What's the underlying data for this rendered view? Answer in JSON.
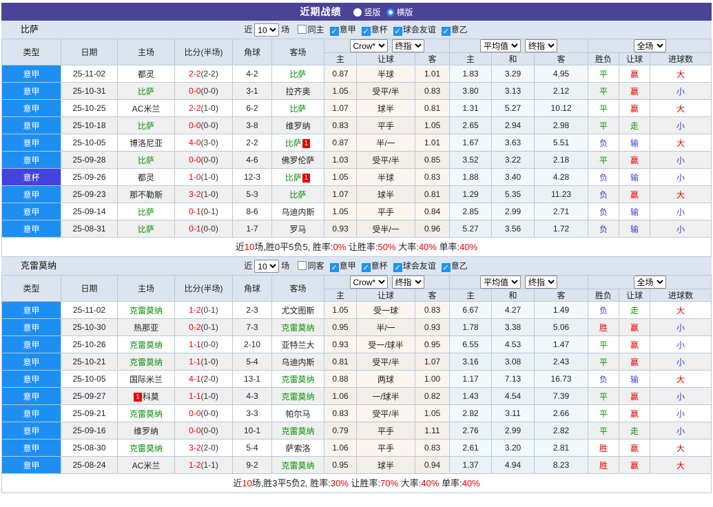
{
  "title_bar": {
    "title": "近期战绩",
    "radios": [
      {
        "label": "竖版",
        "selected": false
      },
      {
        "label": "横版",
        "selected": true
      }
    ]
  },
  "table_header": {
    "left_cols": [
      "类型",
      "日期",
      "主场",
      "比分(半场)",
      "角球",
      "客场"
    ],
    "groups": [
      {
        "selects": [
          {
            "label": "Crow*",
            "name": "bookmaker-select"
          },
          {
            "label": "终指",
            "name": "final-handicap-select"
          }
        ],
        "cols": [
          "主",
          "让球",
          "客"
        ]
      },
      {
        "selects": [
          {
            "label": "平均值",
            "name": "average-select"
          },
          {
            "label": "终指",
            "name": "final-average-select"
          }
        ],
        "cols": [
          "主",
          "和",
          "客"
        ]
      },
      {
        "selects": [
          {
            "label": "全场",
            "name": "scope-select"
          }
        ],
        "cols": [
          "胜负",
          "让球",
          "进球数"
        ]
      }
    ]
  },
  "sections": [
    {
      "team": "比萨",
      "filter": {
        "near_label": "近",
        "count": "10",
        "games_label": "场",
        "same_label": "同主",
        "same_checked": false,
        "leagues": [
          {
            "label": "意甲",
            "checked": true
          },
          {
            "label": "意杯",
            "checked": true
          },
          {
            "label": "球会友谊",
            "checked": true
          },
          {
            "label": "意乙",
            "checked": true
          }
        ]
      },
      "rows": [
        {
          "type": "意甲",
          "cup": false,
          "date": "25-11-02",
          "home": {
            "name": "都灵"
          },
          "ft": "2-2",
          "ht": "(2-2)",
          "corner": "4-2",
          "away": {
            "name": "比萨",
            "green": true
          },
          "odds": [
            "0.87",
            "半球",
            "1.01"
          ],
          "avg": [
            "1.83",
            "3.29",
            "4.95"
          ],
          "res": [
            [
              "平",
              "g"
            ],
            [
              "赢",
              "r"
            ],
            [
              "大",
              "r"
            ]
          ]
        },
        {
          "type": "意甲",
          "cup": false,
          "date": "25-10-31",
          "home": {
            "name": "比萨",
            "green": true
          },
          "ft": "0-0",
          "ht": "(0-0)",
          "corner": "3-1",
          "away": {
            "name": "拉齐奥"
          },
          "odds": [
            "1.05",
            "受平/半",
            "0.83"
          ],
          "avg": [
            "3.80",
            "3.13",
            "2.12"
          ],
          "res": [
            [
              "平",
              "g"
            ],
            [
              "赢",
              "r"
            ],
            [
              "小",
              "b"
            ]
          ]
        },
        {
          "type": "意甲",
          "cup": false,
          "date": "25-10-25",
          "home": {
            "name": "AC米兰"
          },
          "ft": "2-2",
          "ht": "(1-0)",
          "corner": "6-2",
          "away": {
            "name": "比萨",
            "green": true
          },
          "odds": [
            "1.07",
            "球半",
            "0.81"
          ],
          "avg": [
            "1.31",
            "5.27",
            "10.12"
          ],
          "res": [
            [
              "平",
              "g"
            ],
            [
              "赢",
              "r"
            ],
            [
              "大",
              "r"
            ]
          ]
        },
        {
          "type": "意甲",
          "cup": false,
          "date": "25-10-18",
          "home": {
            "name": "比萨",
            "green": true
          },
          "ft": "0-0",
          "ht": "(0-0)",
          "corner": "3-8",
          "away": {
            "name": "维罗纳"
          },
          "odds": [
            "0.83",
            "平手",
            "1.05"
          ],
          "avg": [
            "2.65",
            "2.94",
            "2.98"
          ],
          "res": [
            [
              "平",
              "g"
            ],
            [
              "走",
              "g"
            ],
            [
              "小",
              "b"
            ]
          ]
        },
        {
          "type": "意甲",
          "cup": false,
          "date": "25-10-05",
          "home": {
            "name": "博洛尼亚"
          },
          "ft": "4-0",
          "ht": "(3-0)",
          "corner": "2-2",
          "away": {
            "name": "比萨",
            "green": true,
            "badge": "1"
          },
          "odds": [
            "0.87",
            "半/一",
            "1.01"
          ],
          "avg": [
            "1.67",
            "3.63",
            "5.51"
          ],
          "res": [
            [
              "负",
              "b"
            ],
            [
              "输",
              "b"
            ],
            [
              "大",
              "r"
            ]
          ]
        },
        {
          "type": "意甲",
          "cup": false,
          "date": "25-09-28",
          "home": {
            "name": "比萨",
            "green": true
          },
          "ft": "0-0",
          "ht": "(0-0)",
          "corner": "4-6",
          "away": {
            "name": "佛罗伦萨"
          },
          "odds": [
            "1.03",
            "受平/半",
            "0.85"
          ],
          "avg": [
            "3.52",
            "3.22",
            "2.18"
          ],
          "res": [
            [
              "平",
              "g"
            ],
            [
              "赢",
              "r"
            ],
            [
              "小",
              "b"
            ]
          ]
        },
        {
          "type": "意杯",
          "cup": true,
          "date": "25-09-26",
          "home": {
            "name": "都灵"
          },
          "ft": "1-0",
          "ht": "(1-0)",
          "corner": "12-3",
          "away": {
            "name": "比萨",
            "green": true,
            "badge": "1"
          },
          "odds": [
            "1.05",
            "半球",
            "0.83"
          ],
          "avg": [
            "1.88",
            "3.40",
            "4.28"
          ],
          "res": [
            [
              "负",
              "b"
            ],
            [
              "输",
              "b"
            ],
            [
              "小",
              "b"
            ]
          ]
        },
        {
          "type": "意甲",
          "cup": false,
          "date": "25-09-23",
          "home": {
            "name": "那不勒斯"
          },
          "ft": "3-2",
          "ht": "(1-0)",
          "corner": "5-3",
          "away": {
            "name": "比萨",
            "green": true
          },
          "odds": [
            "1.07",
            "球半",
            "0.81"
          ],
          "avg": [
            "1.29",
            "5.35",
            "11.23"
          ],
          "res": [
            [
              "负",
              "b"
            ],
            [
              "赢",
              "r"
            ],
            [
              "大",
              "r"
            ]
          ]
        },
        {
          "type": "意甲",
          "cup": false,
          "date": "25-09-14",
          "home": {
            "name": "比萨",
            "green": true
          },
          "ft": "0-1",
          "ht": "(0-1)",
          "corner": "8-6",
          "away": {
            "name": "乌迪内斯"
          },
          "odds": [
            "1.05",
            "平手",
            "0.84"
          ],
          "avg": [
            "2.85",
            "2.99",
            "2.71"
          ],
          "res": [
            [
              "负",
              "b"
            ],
            [
              "输",
              "b"
            ],
            [
              "小",
              "b"
            ]
          ]
        },
        {
          "type": "意甲",
          "cup": false,
          "date": "25-08-31",
          "home": {
            "name": "比萨",
            "green": true
          },
          "ft": "0-1",
          "ht": "(0-0)",
          "corner": "1-7",
          "away": {
            "name": "罗马"
          },
          "odds": [
            "0.93",
            "受半/一",
            "0.96"
          ],
          "avg": [
            "5.27",
            "3.56",
            "1.72"
          ],
          "res": [
            [
              "负",
              "b"
            ],
            [
              "输",
              "b"
            ],
            [
              "小",
              "b"
            ]
          ]
        }
      ],
      "summary": [
        [
          "近",
          0
        ],
        [
          "10",
          1
        ],
        [
          "场,胜0平5负5, 胜率:",
          0
        ],
        [
          "0%",
          1
        ],
        [
          " 让胜率:",
          0
        ],
        [
          "50%",
          1
        ],
        [
          " 大率:",
          0
        ],
        [
          "40%",
          1
        ],
        [
          " 单率:",
          0
        ],
        [
          "40%",
          1
        ]
      ]
    },
    {
      "team": "克雷莫纳",
      "filter": {
        "near_label": "近",
        "count": "10",
        "games_label": "场",
        "same_label": "同客",
        "same_checked": false,
        "leagues": [
          {
            "label": "意甲",
            "checked": true
          },
          {
            "label": "意杯",
            "checked": true
          },
          {
            "label": "球会友谊",
            "checked": true
          },
          {
            "label": "意乙",
            "checked": true
          }
        ]
      },
      "rows": [
        {
          "type": "意甲",
          "cup": false,
          "date": "25-11-02",
          "home": {
            "name": "克雷莫纳",
            "green": true
          },
          "ft": "1-2",
          "ht": "(0-1)",
          "corner": "2-3",
          "away": {
            "name": "尤文图斯"
          },
          "odds": [
            "1.05",
            "受一球",
            "0.83"
          ],
          "avg": [
            "6.67",
            "4.27",
            "1.49"
          ],
          "res": [
            [
              "负",
              "b"
            ],
            [
              "走",
              "g"
            ],
            [
              "大",
              "r"
            ]
          ]
        },
        {
          "type": "意甲",
          "cup": false,
          "date": "25-10-30",
          "home": {
            "name": "热那亚"
          },
          "ft": "0-2",
          "ht": "(0-1)",
          "corner": "7-3",
          "away": {
            "name": "克雷莫纳",
            "green": true
          },
          "odds": [
            "0.95",
            "半/一",
            "0.93"
          ],
          "avg": [
            "1.78",
            "3.38",
            "5.06"
          ],
          "res": [
            [
              "胜",
              "r"
            ],
            [
              "赢",
              "r"
            ],
            [
              "小",
              "b"
            ]
          ]
        },
        {
          "type": "意甲",
          "cup": false,
          "date": "25-10-26",
          "home": {
            "name": "克雷莫纳",
            "green": true
          },
          "ft": "1-1",
          "ht": "(0-0)",
          "corner": "2-10",
          "away": {
            "name": "亚特兰大"
          },
          "odds": [
            "0.93",
            "受一/球半",
            "0.95"
          ],
          "avg": [
            "6.55",
            "4.53",
            "1.47"
          ],
          "res": [
            [
              "平",
              "g"
            ],
            [
              "赢",
              "r"
            ],
            [
              "小",
              "b"
            ]
          ]
        },
        {
          "type": "意甲",
          "cup": false,
          "date": "25-10-21",
          "home": {
            "name": "克雷莫纳",
            "green": true
          },
          "ft": "1-1",
          "ht": "(1-0)",
          "corner": "5-4",
          "away": {
            "name": "乌迪内斯"
          },
          "odds": [
            "0.81",
            "受平/半",
            "1.07"
          ],
          "avg": [
            "3.16",
            "3.08",
            "2.43"
          ],
          "res": [
            [
              "平",
              "g"
            ],
            [
              "赢",
              "r"
            ],
            [
              "小",
              "b"
            ]
          ]
        },
        {
          "type": "意甲",
          "cup": false,
          "date": "25-10-05",
          "home": {
            "name": "国际米兰"
          },
          "ft": "4-1",
          "ht": "(2-0)",
          "corner": "13-1",
          "away": {
            "name": "克雷莫纳",
            "green": true
          },
          "odds": [
            "0.88",
            "两球",
            "1.00"
          ],
          "avg": [
            "1.17",
            "7.13",
            "16.73"
          ],
          "res": [
            [
              "负",
              "b"
            ],
            [
              "输",
              "b"
            ],
            [
              "大",
              "r"
            ]
          ]
        },
        {
          "type": "意甲",
          "cup": false,
          "date": "25-09-27",
          "home": {
            "name": "科莫",
            "badge": "1",
            "badge_pos": "before"
          },
          "ft": "1-1",
          "ht": "(1-0)",
          "corner": "4-3",
          "away": {
            "name": "克雷莫纳",
            "green": true
          },
          "odds": [
            "1.06",
            "一/球半",
            "0.82"
          ],
          "avg": [
            "1.43",
            "4.54",
            "7.39"
          ],
          "res": [
            [
              "平",
              "g"
            ],
            [
              "赢",
              "r"
            ],
            [
              "小",
              "b"
            ]
          ]
        },
        {
          "type": "意甲",
          "cup": false,
          "date": "25-09-21",
          "home": {
            "name": "克雷莫纳",
            "green": true
          },
          "ft": "0-0",
          "ht": "(0-0)",
          "corner": "3-3",
          "away": {
            "name": "帕尔马"
          },
          "odds": [
            "0.83",
            "受平/半",
            "1.05"
          ],
          "avg": [
            "2.82",
            "3.11",
            "2.66"
          ],
          "res": [
            [
              "平",
              "g"
            ],
            [
              "赢",
              "r"
            ],
            [
              "小",
              "b"
            ]
          ]
        },
        {
          "type": "意甲",
          "cup": false,
          "date": "25-09-16",
          "home": {
            "name": "维罗纳"
          },
          "ft": "0-0",
          "ht": "(0-0)",
          "corner": "10-1",
          "away": {
            "name": "克雷莫纳",
            "green": true
          },
          "odds": [
            "0.79",
            "平手",
            "1.11"
          ],
          "avg": [
            "2.76",
            "2.99",
            "2.82"
          ],
          "res": [
            [
              "平",
              "g"
            ],
            [
              "走",
              "g"
            ],
            [
              "小",
              "b"
            ]
          ]
        },
        {
          "type": "意甲",
          "cup": false,
          "date": "25-08-30",
          "home": {
            "name": "克雷莫纳",
            "green": true
          },
          "ft": "3-2",
          "ht": "(2-0)",
          "corner": "5-4",
          "away": {
            "name": "萨索洛"
          },
          "odds": [
            "1.06",
            "平手",
            "0.83"
          ],
          "avg": [
            "2.61",
            "3.20",
            "2.81"
          ],
          "res": [
            [
              "胜",
              "r"
            ],
            [
              "赢",
              "r"
            ],
            [
              "大",
              "r"
            ]
          ]
        },
        {
          "type": "意甲",
          "cup": false,
          "date": "25-08-24",
          "home": {
            "name": "AC米兰"
          },
          "ft": "1-2",
          "ht": "(1-1)",
          "corner": "9-2",
          "away": {
            "name": "克雷莫纳",
            "green": true
          },
          "odds": [
            "0.95",
            "球半",
            "0.94"
          ],
          "avg": [
            "1.37",
            "4.94",
            "8.23"
          ],
          "res": [
            [
              "胜",
              "r"
            ],
            [
              "赢",
              "r"
            ],
            [
              "大",
              "r"
            ]
          ]
        }
      ],
      "summary": [
        [
          "近",
          0
        ],
        [
          "10",
          1
        ],
        [
          "场,胜3平5负2, 胜率:",
          0
        ],
        [
          "30%",
          1
        ],
        [
          " 让胜率:",
          0
        ],
        [
          "70%",
          1
        ],
        [
          " 大率:",
          0
        ],
        [
          "40%",
          1
        ],
        [
          " 单率:",
          0
        ],
        [
          "40%",
          1
        ]
      ]
    }
  ],
  "colors": {
    "title_bar_bg": "#4b4397",
    "league_cell_bg": "#1e8ff2",
    "cup_cell_bg": "#4343e0",
    "team_highlight": "#099109",
    "win_red": "#e60000",
    "lose_blue": "#3d3dcc",
    "draw_green": "#099109"
  }
}
